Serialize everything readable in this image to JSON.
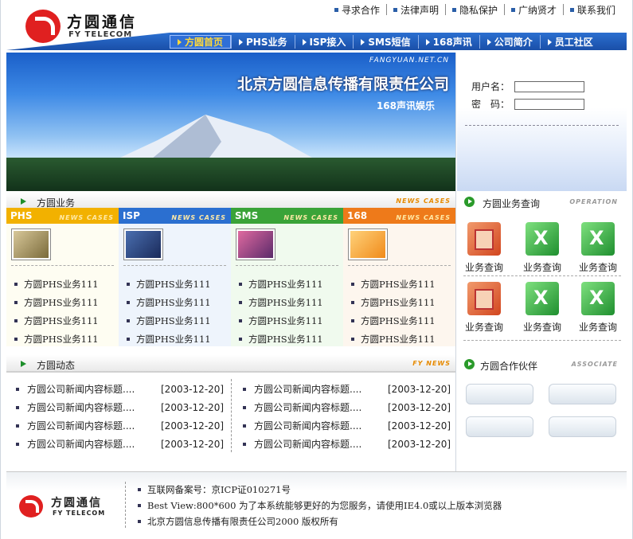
{
  "brand": {
    "cn": "方圆通信",
    "en": "FY TELECOM"
  },
  "toplinks": [
    "寻求合作",
    "法律声明",
    "隐私保护",
    "广纳贤才",
    "联系我们"
  ],
  "nav": [
    "方圆首页",
    "PHS业务",
    "ISP接入",
    "SMS短信",
    "168声讯",
    "公司简介",
    "员工社区"
  ],
  "banner": {
    "web": "FANGYUAN.NET.CN",
    "title": "北京方圆信息传播有限责任公司",
    "sub": "168声讯娱乐"
  },
  "login": {
    "user_label": "用户名：",
    "pass_label": "密　码："
  },
  "business": {
    "title": "方圆业务",
    "tag": "NEWS CASES"
  },
  "columns": [
    {
      "name": "PHS",
      "tag": "NEWS CASES",
      "color": "#f2b100",
      "items": [
        "方圆PHS业务111",
        "方圆PHS业务111",
        "方圆PHS业务111",
        "方圆PHS业务111"
      ]
    },
    {
      "name": "ISP",
      "tag": "NEWS CASES",
      "color": "#2b6fd0",
      "items": [
        "方圆PHS业务111",
        "方圆PHS业务111",
        "方圆PHS业务111",
        "方圆PHS业务111"
      ]
    },
    {
      "name": "SMS",
      "tag": "NEWS CASES",
      "color": "#3aa338",
      "items": [
        "方圆PHS业务111",
        "方圆PHS业务111",
        "方圆PHS业务111",
        "方圆PHS业务111"
      ]
    },
    {
      "name": "168",
      "tag": "NEWS CASES",
      "color": "#ee7a1a",
      "items": [
        "方圆PHS业务111",
        "方圆PHS业务111",
        "方圆PHS业务111",
        "方圆PHS业务111"
      ]
    }
  ],
  "dynamics": {
    "title": "方圆动态",
    "tag": "FY NEWS"
  },
  "news_left": [
    {
      "text": "方圆公司新闻内容标题....",
      "date": "[2003-12-20]"
    },
    {
      "text": "方圆公司新闻内容标题....",
      "date": "[2003-12-20]"
    },
    {
      "text": "方圆公司新闻内容标题....",
      "date": "[2003-12-20]"
    },
    {
      "text": "方圆公司新闻内容标题....",
      "date": "[2003-12-20]"
    }
  ],
  "news_right": [
    {
      "text": "方圆公司新闻内容标题....",
      "date": "[2003-12-20]"
    },
    {
      "text": "方圆公司新闻内容标题....",
      "date": "[2003-12-20]"
    },
    {
      "text": "方圆公司新闻内容标题....",
      "date": "[2003-12-20]"
    },
    {
      "text": "方圆公司新闻内容标题....",
      "date": "[2003-12-20]"
    }
  ],
  "service": {
    "title": "方圆业务查询",
    "tag": "OPERATION",
    "label": "业务查询"
  },
  "partners": {
    "title": "方圆合作伙伴",
    "tag": "ASSOCIATE"
  },
  "footer": {
    "lines": [
      "互联网备案号：京ICP证010271号",
      "Best View:800*600 为了本系统能够更好的为您服务，请使用IE4.0或以上版本浏览器",
      "北京方圆信息传播有限责任公司2000 版权所有"
    ]
  }
}
